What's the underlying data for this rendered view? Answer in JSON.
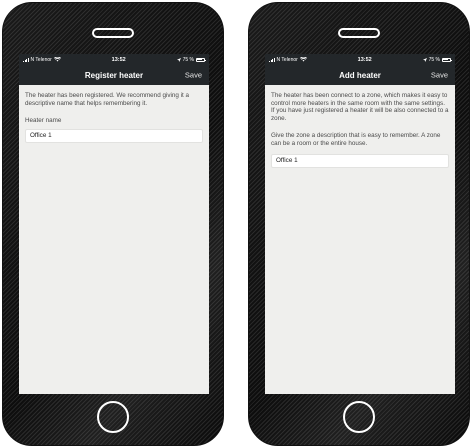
{
  "phones": [
    {
      "status_bar": {
        "carrier": "N Telenor",
        "time": "13:52",
        "battery": "75 %"
      },
      "nav": {
        "title": "Register heater",
        "action": "Save"
      },
      "body": {
        "paragraphs": [
          "The heater has been registered. We recommend giving it a descriptive name that helps remembering it."
        ],
        "field_label": "Heater name",
        "field_value": "Office 1"
      }
    },
    {
      "status_bar": {
        "carrier": "N Telenor",
        "time": "13:52",
        "battery": "75 %"
      },
      "nav": {
        "title": "Add heater",
        "action": "Save"
      },
      "body": {
        "paragraphs": [
          "The heater has been connect to a zone, which makes it easy to control more heaters in the same room with the same settings. If you have just registered a heater it will be also connected to a zone.",
          "Give the zone a description that is easy to remember. A zone can be a room or the entire house."
        ],
        "field_value": "Office 1"
      }
    }
  ],
  "icons": [
    "signal-icon",
    "wifi-icon",
    "location-icon",
    "battery-icon"
  ],
  "colors": {
    "nav_background": "#23272a",
    "screen_background": "#efefed",
    "phone_body": "#111111"
  }
}
